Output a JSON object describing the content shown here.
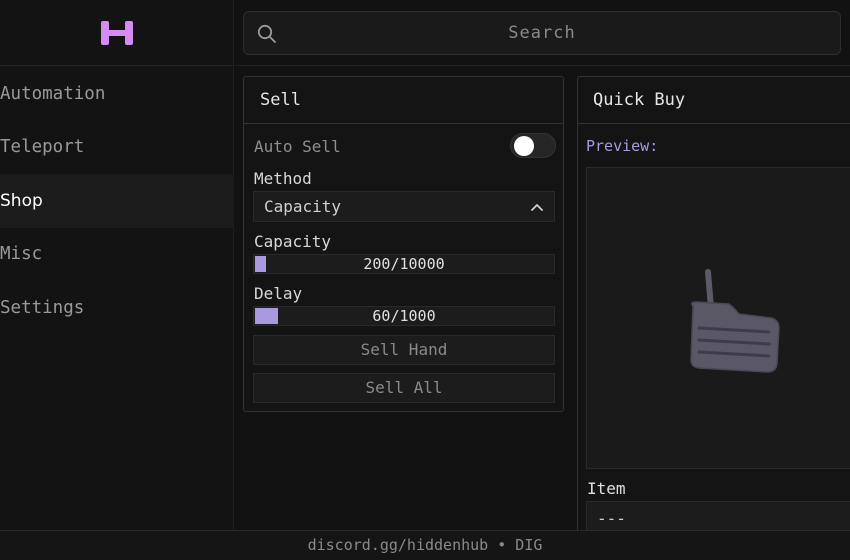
{
  "brand": {
    "logo_icon": "hidden-hub-logo",
    "accent": "#d58cf2"
  },
  "sidebar": {
    "items": [
      {
        "label": "Automation",
        "active": false
      },
      {
        "label": "Teleport",
        "active": false
      },
      {
        "label": "Shop",
        "active": true
      },
      {
        "label": "Misc",
        "active": false
      },
      {
        "label": "Settings",
        "active": false
      }
    ]
  },
  "search": {
    "placeholder": "Search",
    "icon": "search-icon"
  },
  "sell_panel": {
    "title": "Sell",
    "auto_sell": {
      "label": "Auto Sell",
      "enabled": false
    },
    "method": {
      "label": "Method",
      "value": "Capacity",
      "icon": "chevron-up-icon"
    },
    "capacity": {
      "label": "Capacity",
      "display": "200/10000",
      "value": 200,
      "max": 10000
    },
    "delay": {
      "label": "Delay",
      "display": "60/1000",
      "value": 60,
      "max": 1000
    },
    "sell_hand_label": "Sell Hand",
    "sell_all_label": "Sell All",
    "slider_color": "#a99ae0"
  },
  "quick_buy": {
    "title": "Quick Buy",
    "preview_label": "Preview:",
    "preview_item_icon": "shovel-item-icon",
    "item_label": "Item",
    "item_value": "---"
  },
  "footer": {
    "text": "discord.gg/hiddenhub • DIG"
  }
}
